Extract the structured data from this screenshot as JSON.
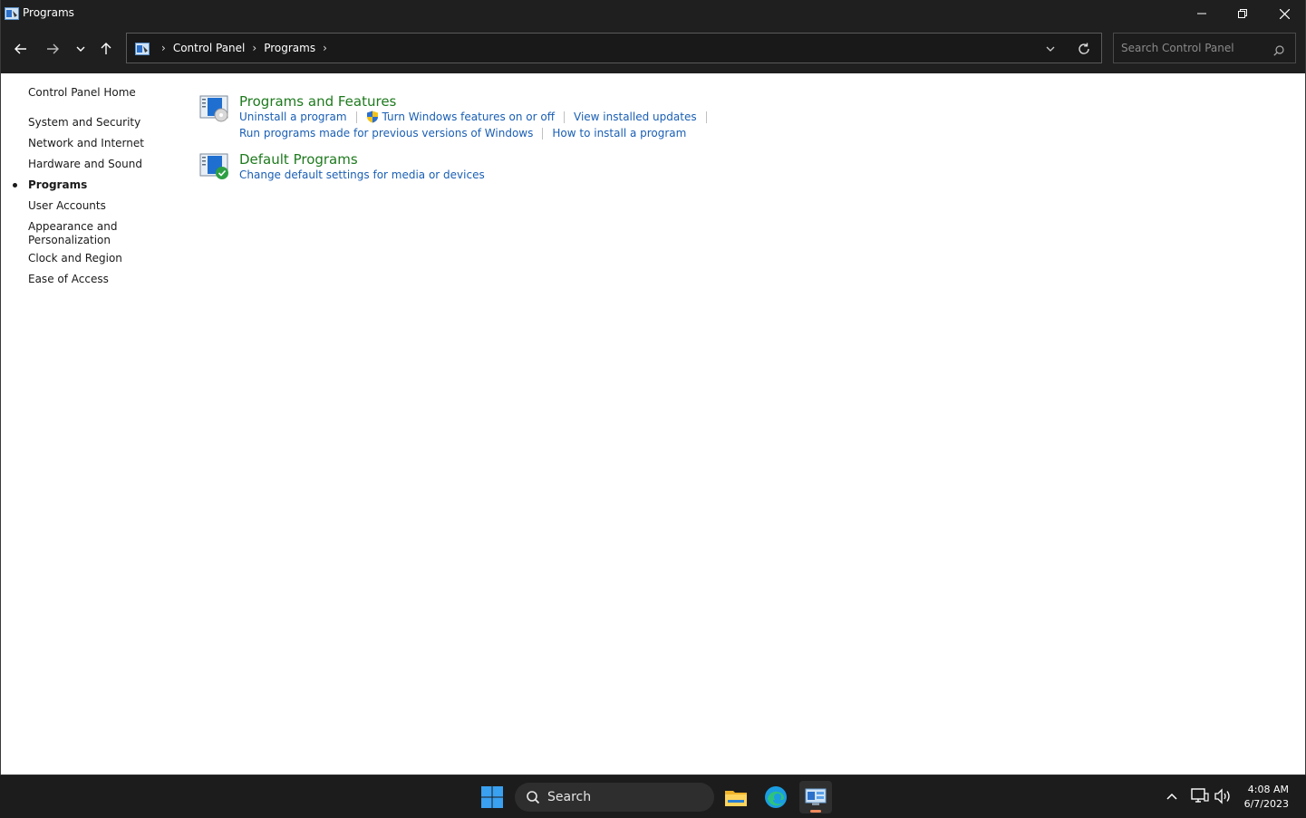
{
  "window": {
    "title": "Programs"
  },
  "address": {
    "crumbs": [
      "Control Panel",
      "Programs"
    ]
  },
  "search": {
    "placeholder": "Search Control Panel"
  },
  "sidebar": {
    "home": "Control Panel Home",
    "items": [
      {
        "label": "System and Security"
      },
      {
        "label": "Network and Internet"
      },
      {
        "label": "Hardware and Sound"
      },
      {
        "label": "Programs",
        "active": true
      },
      {
        "label": "User Accounts"
      },
      {
        "label": "Appearance and Personalization"
      },
      {
        "label": "Clock and Region"
      },
      {
        "label": "Ease of Access"
      }
    ]
  },
  "categories": [
    {
      "title": "Programs and Features",
      "icon": "programs-features-icon",
      "links_row1": [
        "Uninstall a program",
        "Turn Windows features on or off",
        "View installed updates"
      ],
      "links_row2": [
        "Run programs made for previous versions of Windows",
        "How to install a program"
      ]
    },
    {
      "title": "Default Programs",
      "icon": "default-programs-icon",
      "links_row1": [
        "Change default settings for media or devices"
      ]
    }
  ],
  "taskbar": {
    "search_label": "Search",
    "time": "4:08 AM",
    "date": "6/7/2023",
    "apps": [
      "start-icon",
      "file-explorer-icon",
      "edge-icon",
      "control-panel-icon"
    ]
  },
  "colors": {
    "chrome": "#1f1f1f",
    "category_title": "#1e7a1e",
    "link": "#1a5fb4",
    "taskbar": "#1c1c1c"
  }
}
